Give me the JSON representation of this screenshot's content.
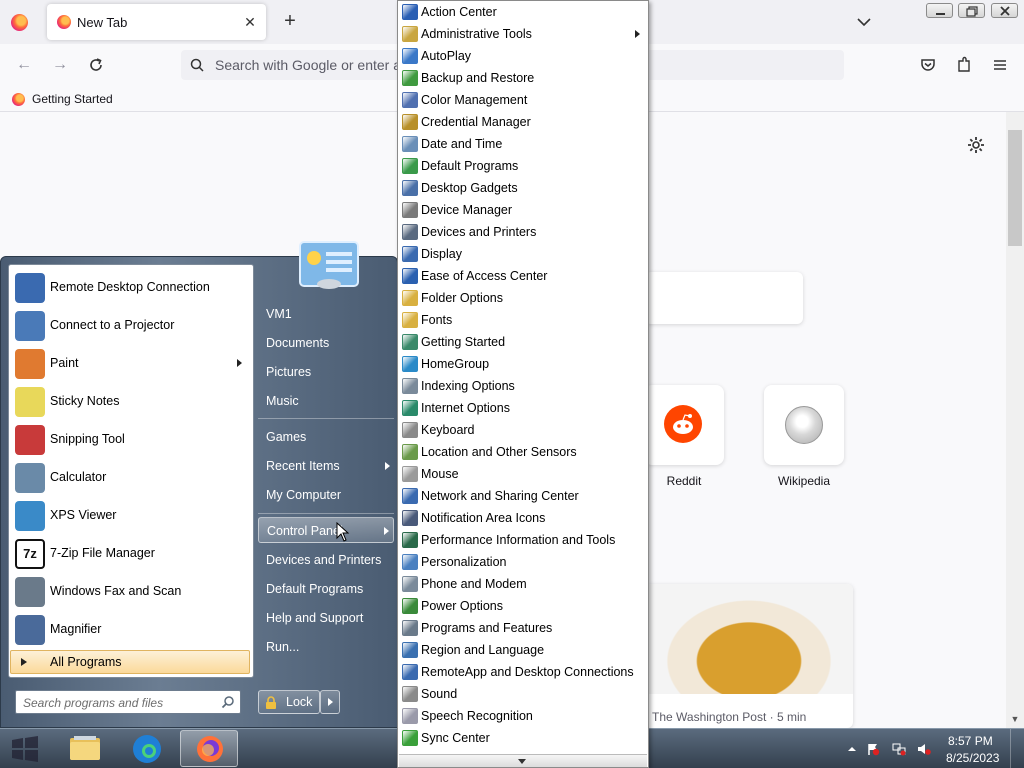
{
  "browser": {
    "tab_title": "New Tab",
    "url_placeholder": "Search with Google or enter a",
    "bookmark": "Getting Started",
    "shortcuts": [
      {
        "label": "Reddit"
      },
      {
        "label": "Wikipedia"
      }
    ],
    "story_source": "The Washington Post · 5 min"
  },
  "start_menu": {
    "programs": [
      {
        "label": "Remote Desktop Connection",
        "icon": "remote-desktop-icon"
      },
      {
        "label": "Connect to a Projector",
        "icon": "projector-icon"
      },
      {
        "label": "Paint",
        "icon": "paint-icon",
        "submenu": true
      },
      {
        "label": "Sticky Notes",
        "icon": "sticky-notes-icon"
      },
      {
        "label": "Snipping Tool",
        "icon": "snipping-tool-icon"
      },
      {
        "label": "Calculator",
        "icon": "calculator-icon"
      },
      {
        "label": "XPS Viewer",
        "icon": "xps-viewer-icon"
      },
      {
        "label": "7-Zip File Manager",
        "icon": "7zip-icon"
      },
      {
        "label": "Windows Fax and Scan",
        "icon": "fax-scan-icon"
      },
      {
        "label": "Magnifier",
        "icon": "magnifier-icon"
      }
    ],
    "all_programs": "All Programs",
    "search_placeholder": "Search programs and files",
    "right": {
      "vm1": "VM1",
      "documents": "Documents",
      "pictures": "Pictures",
      "music": "Music",
      "games": "Games",
      "recent_items": "Recent Items",
      "my_computer": "My Computer",
      "control_panel": "Control Panel",
      "devices_printers": "Devices and Printers",
      "default_programs": "Default Programs",
      "help_support": "Help and Support",
      "run": "Run..."
    },
    "lock": "Lock"
  },
  "control_panel_items": [
    {
      "label": "Action Center",
      "color": "#2a5fb4"
    },
    {
      "label": "Administrative Tools",
      "color": "#c9a640",
      "submenu": true
    },
    {
      "label": "AutoPlay",
      "color": "#3a78c8"
    },
    {
      "label": "Backup and Restore",
      "color": "#3f9a3f"
    },
    {
      "label": "Color Management",
      "color": "#5070b0"
    },
    {
      "label": "Credential Manager",
      "color": "#b8902a"
    },
    {
      "label": "Date and Time",
      "color": "#6a8fb8"
    },
    {
      "label": "Default Programs",
      "color": "#3a9a4a"
    },
    {
      "label": "Desktop Gadgets",
      "color": "#4a70a8"
    },
    {
      "label": "Device Manager",
      "color": "#7a7a7a"
    },
    {
      "label": "Devices and Printers",
      "color": "#5a6a80"
    },
    {
      "label": "Display",
      "color": "#3a6ab0"
    },
    {
      "label": "Ease of Access Center",
      "color": "#2a60b0"
    },
    {
      "label": "Folder Options",
      "color": "#d8b040"
    },
    {
      "label": "Fonts",
      "color": "#d8b040"
    },
    {
      "label": "Getting Started",
      "color": "#3a8a6a"
    },
    {
      "label": "HomeGroup",
      "color": "#2a8ac8"
    },
    {
      "label": "Indexing Options",
      "color": "#7a8a9a"
    },
    {
      "label": "Internet Options",
      "color": "#2a8a6a"
    },
    {
      "label": "Keyboard",
      "color": "#8a8a8a"
    },
    {
      "label": "Location and Other Sensors",
      "color": "#6a9a4a"
    },
    {
      "label": "Mouse",
      "color": "#9a9a9a"
    },
    {
      "label": "Network and Sharing Center",
      "color": "#3a6ab0"
    },
    {
      "label": "Notification Area Icons",
      "color": "#4a5a7a"
    },
    {
      "label": "Performance Information and Tools",
      "color": "#2a6a4a"
    },
    {
      "label": "Personalization",
      "color": "#4a80c0"
    },
    {
      "label": "Phone and Modem",
      "color": "#7a8a9a"
    },
    {
      "label": "Power Options",
      "color": "#3a8a3a"
    },
    {
      "label": "Programs and Features",
      "color": "#6a7a8a"
    },
    {
      "label": "Region and Language",
      "color": "#3a70b0"
    },
    {
      "label": "RemoteApp and Desktop Connections",
      "color": "#3a6ab0"
    },
    {
      "label": "Sound",
      "color": "#8a8a8a"
    },
    {
      "label": "Speech Recognition",
      "color": "#9a9aaa"
    },
    {
      "label": "Sync Center",
      "color": "#3aa03a"
    }
  ],
  "taskbar": {
    "clock_time": "8:57 PM",
    "clock_date": "8/25/2023"
  }
}
